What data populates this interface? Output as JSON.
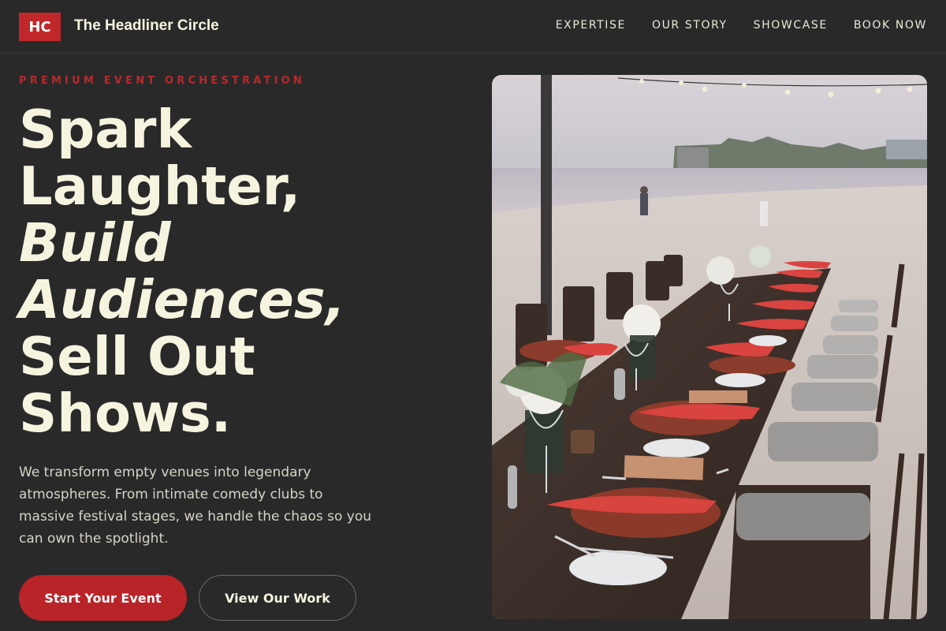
{
  "header": {
    "logo": "HC",
    "brand": "The Headliner Circle",
    "nav": [
      "EXPERTISE",
      "OUR STORY",
      "SHOWCASE",
      "BOOK NOW"
    ]
  },
  "hero": {
    "eyebrow": "PREMIUM EVENT ORCHESTRATION",
    "headline": {
      "line1": "Spark",
      "line2": "Laughter,",
      "line3": "Build",
      "line4": "Audiences,",
      "line5": "Sell Out",
      "line6": "Shows."
    },
    "description": "We transform empty venues into legendary atmospheres. From intimate comedy clubs to massive festival stages, we handle the chaos so you can own the spotlight.",
    "primary_cta": "Start Your Event",
    "secondary_cta": "View Our Work"
  },
  "colors": {
    "background": "#2a292a",
    "accent": "#b92428",
    "text": "#f6f4df"
  }
}
